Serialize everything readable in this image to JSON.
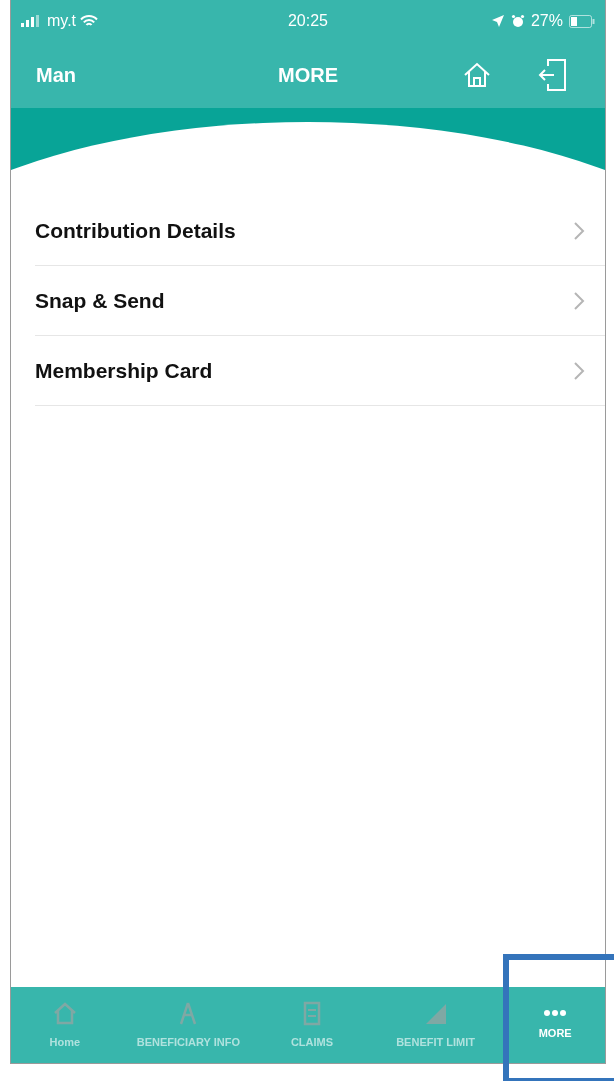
{
  "status_bar": {
    "carrier": "my.t",
    "time": "20:25",
    "battery": "27%"
  },
  "nav_bar": {
    "user": "Man",
    "title": "MORE"
  },
  "menu": [
    {
      "label": "Contribution Details"
    },
    {
      "label": "Snap & Send"
    },
    {
      "label": "Membership Card"
    }
  ],
  "tab_bar": [
    {
      "kind": "home",
      "label": "Home",
      "selected": false
    },
    {
      "kind": "person",
      "label": "BENEFICIARY INFO",
      "selected": false
    },
    {
      "kind": "document",
      "label": "CLAIMS",
      "selected": false
    },
    {
      "kind": "chart",
      "label": "BENEFIT LIMIT",
      "selected": false
    },
    {
      "kind": "more",
      "label": "MORE",
      "selected": true,
      "highlighted": true
    }
  ]
}
